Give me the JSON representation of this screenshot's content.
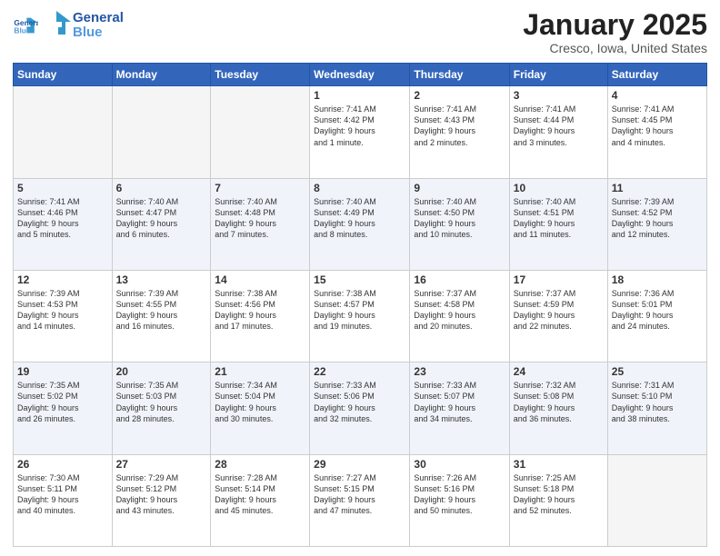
{
  "logo": {
    "line1": "General",
    "line2": "Blue"
  },
  "header": {
    "month": "January 2025",
    "location": "Cresco, Iowa, United States"
  },
  "days_of_week": [
    "Sunday",
    "Monday",
    "Tuesday",
    "Wednesday",
    "Thursday",
    "Friday",
    "Saturday"
  ],
  "weeks": [
    [
      {
        "num": "",
        "info": ""
      },
      {
        "num": "",
        "info": ""
      },
      {
        "num": "",
        "info": ""
      },
      {
        "num": "1",
        "info": "Sunrise: 7:41 AM\nSunset: 4:42 PM\nDaylight: 9 hours\nand 1 minute."
      },
      {
        "num": "2",
        "info": "Sunrise: 7:41 AM\nSunset: 4:43 PM\nDaylight: 9 hours\nand 2 minutes."
      },
      {
        "num": "3",
        "info": "Sunrise: 7:41 AM\nSunset: 4:44 PM\nDaylight: 9 hours\nand 3 minutes."
      },
      {
        "num": "4",
        "info": "Sunrise: 7:41 AM\nSunset: 4:45 PM\nDaylight: 9 hours\nand 4 minutes."
      }
    ],
    [
      {
        "num": "5",
        "info": "Sunrise: 7:41 AM\nSunset: 4:46 PM\nDaylight: 9 hours\nand 5 minutes."
      },
      {
        "num": "6",
        "info": "Sunrise: 7:40 AM\nSunset: 4:47 PM\nDaylight: 9 hours\nand 6 minutes."
      },
      {
        "num": "7",
        "info": "Sunrise: 7:40 AM\nSunset: 4:48 PM\nDaylight: 9 hours\nand 7 minutes."
      },
      {
        "num": "8",
        "info": "Sunrise: 7:40 AM\nSunset: 4:49 PM\nDaylight: 9 hours\nand 8 minutes."
      },
      {
        "num": "9",
        "info": "Sunrise: 7:40 AM\nSunset: 4:50 PM\nDaylight: 9 hours\nand 10 minutes."
      },
      {
        "num": "10",
        "info": "Sunrise: 7:40 AM\nSunset: 4:51 PM\nDaylight: 9 hours\nand 11 minutes."
      },
      {
        "num": "11",
        "info": "Sunrise: 7:39 AM\nSunset: 4:52 PM\nDaylight: 9 hours\nand 12 minutes."
      }
    ],
    [
      {
        "num": "12",
        "info": "Sunrise: 7:39 AM\nSunset: 4:53 PM\nDaylight: 9 hours\nand 14 minutes."
      },
      {
        "num": "13",
        "info": "Sunrise: 7:39 AM\nSunset: 4:55 PM\nDaylight: 9 hours\nand 16 minutes."
      },
      {
        "num": "14",
        "info": "Sunrise: 7:38 AM\nSunset: 4:56 PM\nDaylight: 9 hours\nand 17 minutes."
      },
      {
        "num": "15",
        "info": "Sunrise: 7:38 AM\nSunset: 4:57 PM\nDaylight: 9 hours\nand 19 minutes."
      },
      {
        "num": "16",
        "info": "Sunrise: 7:37 AM\nSunset: 4:58 PM\nDaylight: 9 hours\nand 20 minutes."
      },
      {
        "num": "17",
        "info": "Sunrise: 7:37 AM\nSunset: 4:59 PM\nDaylight: 9 hours\nand 22 minutes."
      },
      {
        "num": "18",
        "info": "Sunrise: 7:36 AM\nSunset: 5:01 PM\nDaylight: 9 hours\nand 24 minutes."
      }
    ],
    [
      {
        "num": "19",
        "info": "Sunrise: 7:35 AM\nSunset: 5:02 PM\nDaylight: 9 hours\nand 26 minutes."
      },
      {
        "num": "20",
        "info": "Sunrise: 7:35 AM\nSunset: 5:03 PM\nDaylight: 9 hours\nand 28 minutes."
      },
      {
        "num": "21",
        "info": "Sunrise: 7:34 AM\nSunset: 5:04 PM\nDaylight: 9 hours\nand 30 minutes."
      },
      {
        "num": "22",
        "info": "Sunrise: 7:33 AM\nSunset: 5:06 PM\nDaylight: 9 hours\nand 32 minutes."
      },
      {
        "num": "23",
        "info": "Sunrise: 7:33 AM\nSunset: 5:07 PM\nDaylight: 9 hours\nand 34 minutes."
      },
      {
        "num": "24",
        "info": "Sunrise: 7:32 AM\nSunset: 5:08 PM\nDaylight: 9 hours\nand 36 minutes."
      },
      {
        "num": "25",
        "info": "Sunrise: 7:31 AM\nSunset: 5:10 PM\nDaylight: 9 hours\nand 38 minutes."
      }
    ],
    [
      {
        "num": "26",
        "info": "Sunrise: 7:30 AM\nSunset: 5:11 PM\nDaylight: 9 hours\nand 40 minutes."
      },
      {
        "num": "27",
        "info": "Sunrise: 7:29 AM\nSunset: 5:12 PM\nDaylight: 9 hours\nand 43 minutes."
      },
      {
        "num": "28",
        "info": "Sunrise: 7:28 AM\nSunset: 5:14 PM\nDaylight: 9 hours\nand 45 minutes."
      },
      {
        "num": "29",
        "info": "Sunrise: 7:27 AM\nSunset: 5:15 PM\nDaylight: 9 hours\nand 47 minutes."
      },
      {
        "num": "30",
        "info": "Sunrise: 7:26 AM\nSunset: 5:16 PM\nDaylight: 9 hours\nand 50 minutes."
      },
      {
        "num": "31",
        "info": "Sunrise: 7:25 AM\nSunset: 5:18 PM\nDaylight: 9 hours\nand 52 minutes."
      },
      {
        "num": "",
        "info": ""
      }
    ]
  ]
}
